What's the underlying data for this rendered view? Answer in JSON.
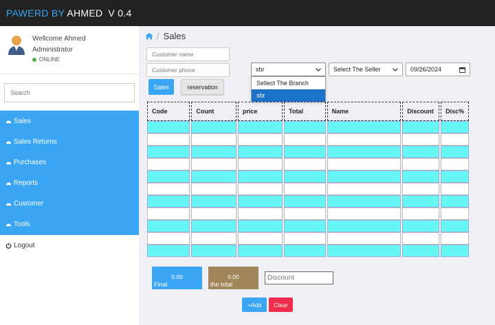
{
  "header": {
    "brand_prefix": "PAWERD BY ",
    "brand_name": "AHMED",
    "version": "V 0.4"
  },
  "user": {
    "welcome": "Wellcome Ahmed",
    "role": "Administrator",
    "status": "ONLINE"
  },
  "sidebar": {
    "search_placeholder": "Search",
    "items": [
      {
        "label": "Sales",
        "icon": "dashboard-icon"
      },
      {
        "label": "Sales Returns",
        "icon": "dashboard-icon"
      },
      {
        "label": "Purchases",
        "icon": "dashboard-icon"
      },
      {
        "label": "Reports",
        "icon": "dashboard-icon"
      },
      {
        "label": "Customer",
        "icon": "dashboard-icon"
      },
      {
        "label": "Tools",
        "icon": "dashboard-icon"
      }
    ],
    "logout": "Logout"
  },
  "page": {
    "title": "Sales"
  },
  "form": {
    "customer_name_placeholder": "Customer name",
    "customer_phone_placeholder": "Customer phone",
    "branch_selected": "sbr",
    "branch_options": [
      "Sellect The Branch",
      "sbr"
    ],
    "seller_selected": "Select The Seller",
    "date": "09/26/2024",
    "sales_btn": "Sales",
    "reservation_btn": "reservation"
  },
  "table": {
    "headers": [
      "Code",
      "Count",
      "price",
      "Total",
      "Name",
      "Discount",
      "Disc%"
    ]
  },
  "totals": {
    "final_value": "0.00",
    "final_label": "Final",
    "total_value": "0.00",
    "total_label": "the total",
    "discount_placeholder": "Discount"
  },
  "actions": {
    "add": "+Add",
    "clear": "Clear"
  },
  "colors": {
    "accent": "#3aa6f3",
    "row_cyan": "#66f7f5",
    "clear": "#f02d4d",
    "total_box": "#a08658"
  }
}
